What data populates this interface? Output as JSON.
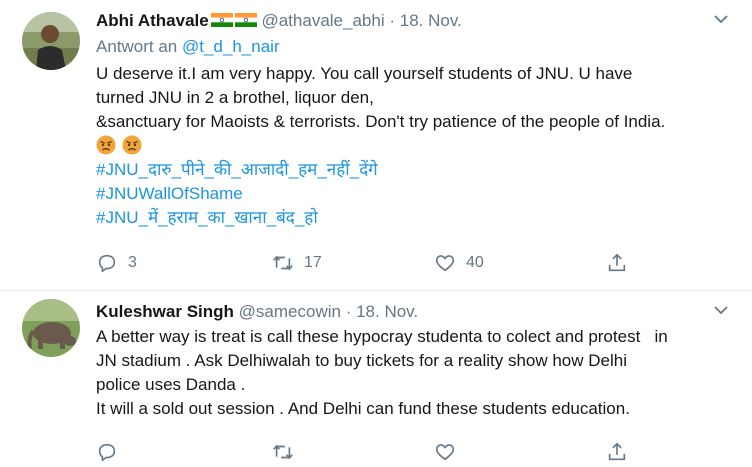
{
  "tweets": [
    {
      "name": "Abhi Athavale",
      "handle": "@athavale_abhi",
      "separator": "·",
      "date": "18. Nov.",
      "reply_prefix": "Antwort an",
      "reply_mention": "@t_d_h_nair",
      "lines": [
        "U deserve it.I am very happy. You call yourself students of JNU. U have",
        "turned JNU in 2 a brothel, liquor den,",
        "&sanctuary for Maoists & terrorists. Don't try patience of the people of India."
      ],
      "emojis": [
        "angry-face",
        "angry-face"
      ],
      "hashtags": [
        "#JNU_दारु_पीने_की_आजादी_हम_नहीं_देंगे",
        "#JNUWallOfShame",
        "#JNU_में_हराम_का_खाना_बंद_हो"
      ],
      "replies": "3",
      "retweets": "17",
      "likes": "40"
    },
    {
      "name": "Kuleshwar Singh",
      "handle": "@samecowin",
      "separator": "·",
      "date": "18. Nov.",
      "lines": [
        "A better way is treat is call these hypocray studenta to colect and protest   in",
        "JN stadium . Ask Delhiwalah to buy tickets for a reality show how Delhi",
        "police uses Danda .",
        "It will a sold out session . And Delhi can fund these students education."
      ]
    }
  ],
  "colors": {
    "link": "#1b95e0",
    "secondary_text": "#657786",
    "divider": "#e6ecf0",
    "emoji": "#f2a33a"
  }
}
